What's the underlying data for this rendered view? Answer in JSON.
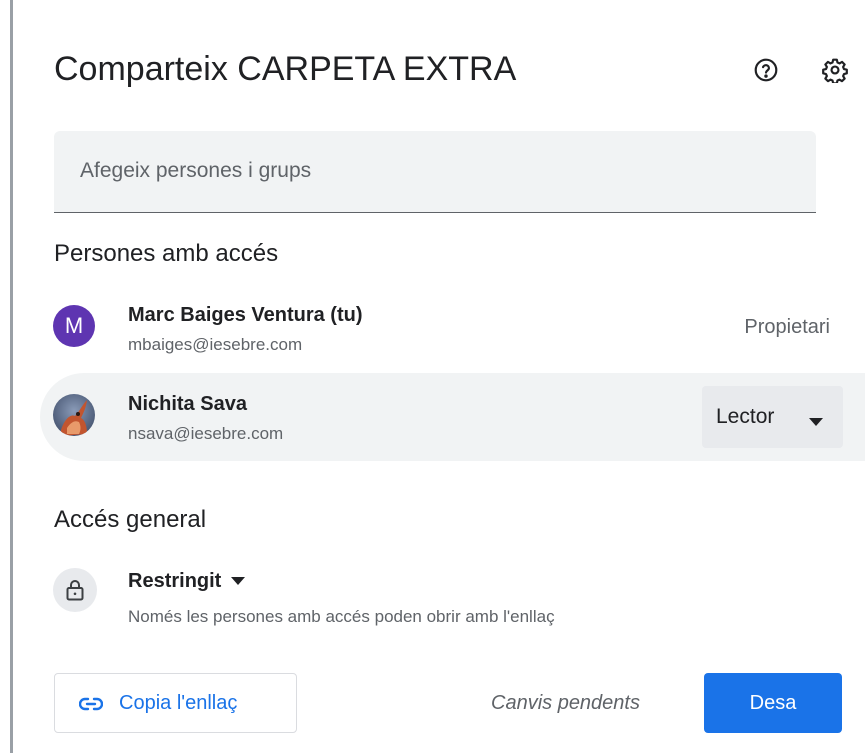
{
  "dialog": {
    "title": "Comparteix CARPETA EXTRA",
    "icons": {
      "help": "help-icon",
      "settings": "gear-icon"
    }
  },
  "add_people": {
    "placeholder": "Afegeix persones i grups",
    "value": ""
  },
  "people_section": {
    "title": "Persones amb accés",
    "people": [
      {
        "name": "Marc Baiges Ventura (tu)",
        "email": "mbaiges@iesebre.com",
        "avatar_letter": "M",
        "avatar_color": "#5e35b1",
        "role": "Propietari"
      },
      {
        "name": "Nichita Sava",
        "email": "nsava@iesebre.com",
        "avatar_letter": "",
        "role": "Lector"
      }
    ]
  },
  "general_access": {
    "title": "Accés general",
    "selected": "Restringit",
    "description": "Només les persones amb accés poden obrir amb l'enllaç",
    "icon": "lock-icon"
  },
  "footer": {
    "copy_link_label": "Copia l'enllaç",
    "pending_text": "Canvis pendents",
    "save_label": "Desa"
  },
  "colors": {
    "accent": "#1a73e8",
    "avatar": "#5e35b1",
    "selected_row": "#f1f3f4"
  }
}
